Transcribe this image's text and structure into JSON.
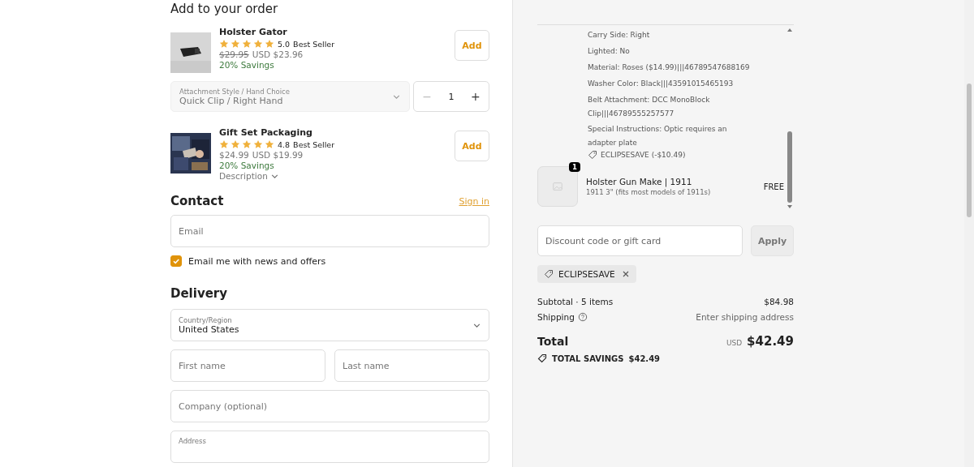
{
  "upsell": {
    "heading": "Add to your order",
    "products": [
      {
        "name": "Holster Gator",
        "stars": 5,
        "rating": "5.0",
        "badge": "Best Seller",
        "old_price": "$29.95",
        "old_price_struck": true,
        "price": "USD $23.96",
        "savings": "20% Savings",
        "add": "Add",
        "variant": {
          "label": "Attachment Style / Hand Choice",
          "value": "Quick Clip / Right Hand",
          "qty": "1",
          "minus": "−",
          "plus": "+"
        }
      },
      {
        "name": "Gift Set Packaging",
        "stars": 5,
        "rating": "4.8",
        "badge": "Best Seller",
        "old_price": "$24.99",
        "old_price_struck": false,
        "price": "USD $19.99",
        "savings": "20% Savings",
        "add": "Add",
        "description": "Description"
      }
    ]
  },
  "contact": {
    "heading": "Contact",
    "sign_in": "Sign in",
    "email": {
      "placeholder": "Email"
    },
    "newsletter": {
      "label": "Email me with news and offers",
      "checked": true
    }
  },
  "delivery": {
    "heading": "Delivery",
    "country": {
      "label": "Country/Region",
      "value": "United States"
    },
    "first_name": {
      "placeholder": "First name"
    },
    "last_name": {
      "placeholder": "Last name"
    },
    "company": {
      "placeholder": "Company (optional)"
    },
    "address": {
      "label": "Address"
    }
  },
  "summary": {
    "properties": [
      "Carry Side: Right",
      "Lighted: No",
      "Material: Roses ($14.99)|||46789547688169",
      "Washer Color: Black|||43591015465193",
      "Belt Attachment: DCC MonoBlock Clip|||46789555257577",
      "Special Instructions: Optic requires an adapter plate"
    ],
    "line_discount": "ECLIPSESAVE (-$10.49)",
    "item": {
      "quantity": "1",
      "name": "Holster Gun Make | 1911",
      "variant": "1911 3\" (fits most models of 1911s)",
      "price": "FREE"
    },
    "discount": {
      "placeholder": "Discount code or gift card",
      "apply": "Apply"
    },
    "applied_code": "ECLIPSESAVE",
    "subtotal": {
      "label": "Subtotal · 5 items",
      "value": "$84.98"
    },
    "shipping": {
      "label": "Shipping",
      "value": "Enter shipping address"
    },
    "total": {
      "label": "Total",
      "currency": "USD",
      "value": "$42.49"
    },
    "savings": {
      "label": "TOTAL SAVINGS",
      "value": "$42.49"
    }
  }
}
